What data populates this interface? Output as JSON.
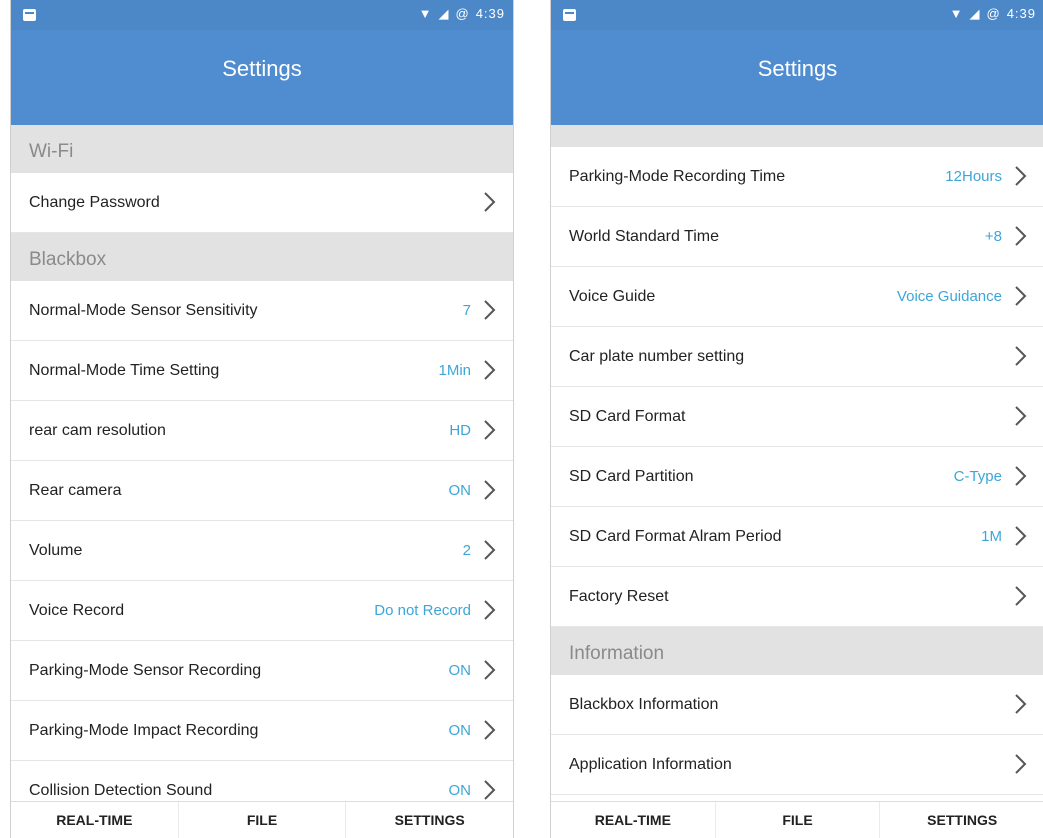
{
  "status": {
    "time": "4:39",
    "battery": "@"
  },
  "left": {
    "title": "Settings",
    "sections": [
      {
        "type": "section",
        "label": "Wi-Fi"
      },
      {
        "type": "row",
        "label": "Change Password",
        "value": ""
      },
      {
        "type": "section",
        "label": "Blackbox"
      },
      {
        "type": "row",
        "label": "Normal-Mode Sensor Sensitivity",
        "value": "7"
      },
      {
        "type": "row",
        "label": "Normal-Mode Time Setting",
        "value": "1Min"
      },
      {
        "type": "row",
        "label": "rear cam resolution",
        "value": "HD"
      },
      {
        "type": "row",
        "label": "Rear camera",
        "value": "ON"
      },
      {
        "type": "row",
        "label": "Volume",
        "value": "2"
      },
      {
        "type": "row",
        "label": "Voice Record",
        "value": "Do not Record"
      },
      {
        "type": "row",
        "label": "Parking-Mode Sensor Recording",
        "value": "ON"
      },
      {
        "type": "row",
        "label": "Parking-Mode Impact Recording",
        "value": "ON"
      },
      {
        "type": "row",
        "label": "Collision Detection Sound",
        "value": "ON"
      }
    ],
    "nav": [
      "REAL-TIME",
      "FILE",
      "SETTINGS"
    ]
  },
  "right": {
    "title": "Settings",
    "sections": [
      {
        "type": "spacer"
      },
      {
        "type": "row",
        "label": "Parking-Mode Recording Time",
        "value": "12Hours"
      },
      {
        "type": "row",
        "label": "World Standard Time",
        "value": "+8"
      },
      {
        "type": "row",
        "label": "Voice Guide",
        "value": "Voice Guidance"
      },
      {
        "type": "row",
        "label": "Car plate number setting",
        "value": ""
      },
      {
        "type": "row",
        "label": "SD Card Format",
        "value": ""
      },
      {
        "type": "row",
        "label": "SD Card Partition",
        "value": "C-Type"
      },
      {
        "type": "row",
        "label": "SD Card Format Alram Period",
        "value": "1M"
      },
      {
        "type": "row",
        "label": "Factory Reset",
        "value": ""
      },
      {
        "type": "section",
        "label": "Information"
      },
      {
        "type": "row",
        "label": "Blackbox Information",
        "value": ""
      },
      {
        "type": "row",
        "label": "Application Information",
        "value": ""
      }
    ],
    "nav": [
      "REAL-TIME",
      "FILE",
      "SETTINGS"
    ]
  },
  "colors": {
    "appbar": "#4f8dd0",
    "statusbar": "#4c87c8",
    "value": "#3ca6d9",
    "section": "#e2e2e2"
  },
  "icons": {
    "status": [
      "wifi-icon",
      "signal-icon",
      "battery-icon"
    ],
    "row": "chevron-right-icon"
  }
}
